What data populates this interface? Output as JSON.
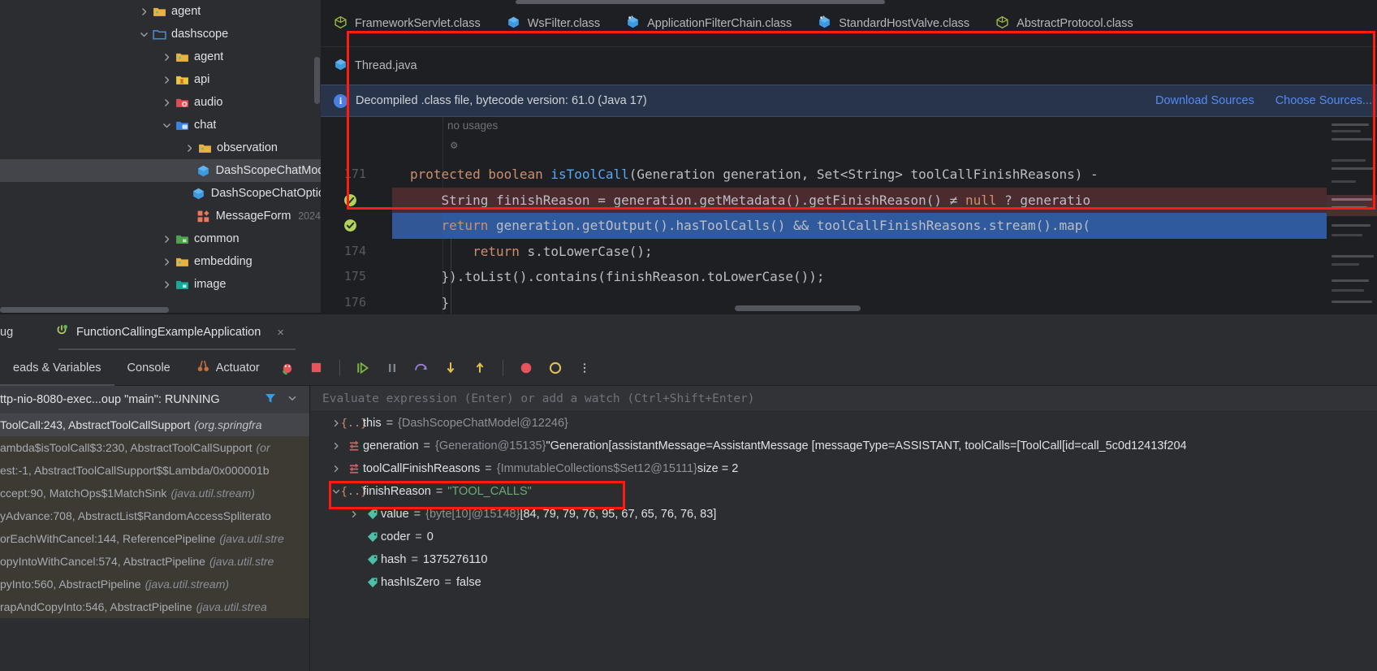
{
  "project_tree": {
    "items": [
      {
        "label": "agent",
        "indent": 1,
        "chevron": "right",
        "icon": "folder-yellow",
        "selected": false
      },
      {
        "label": "dashscope",
        "indent": 1,
        "chevron": "down",
        "icon": "folder-outline-blue",
        "selected": false
      },
      {
        "label": "agent",
        "indent": 2,
        "chevron": "right",
        "icon": "folder-yellow",
        "selected": false
      },
      {
        "label": "api",
        "indent": 2,
        "chevron": "right",
        "icon": "folder-api",
        "selected": false
      },
      {
        "label": "audio",
        "indent": 2,
        "chevron": "right",
        "icon": "folder-audio",
        "selected": false
      },
      {
        "label": "chat",
        "indent": 2,
        "chevron": "down",
        "icon": "folder-chat",
        "selected": false
      },
      {
        "label": "observation",
        "indent": 3,
        "chevron": "right",
        "icon": "folder-yellow",
        "selected": false
      },
      {
        "label": "DashScopeChatModel",
        "indent": 4,
        "chevron": "none",
        "icon": "class-blue",
        "selected": true
      },
      {
        "label": "DashScopeChatOptions",
        "indent": 4,
        "chevron": "none",
        "icon": "class-blue",
        "selected": false
      },
      {
        "label": "MessageFormat",
        "indent": 4,
        "chevron": "none",
        "icon": "enum-red",
        "selected": false,
        "date": "2024"
      },
      {
        "label": "common",
        "indent": 2,
        "chevron": "right",
        "icon": "folder-green",
        "selected": false
      },
      {
        "label": "embedding",
        "indent": 2,
        "chevron": "right",
        "icon": "folder-yellow",
        "selected": false
      },
      {
        "label": "image",
        "indent": 2,
        "chevron": "right",
        "icon": "folder-teal",
        "selected": false
      }
    ]
  },
  "editor": {
    "tabs_row1": [
      {
        "label": "FrameworkServlet.class",
        "icon": "class-green",
        "active": false
      },
      {
        "label": "WsFilter.class",
        "icon": "class-blue",
        "active": false
      },
      {
        "label": "ApplicationFilterChain.class",
        "icon": "class-blue-dot",
        "active": false
      },
      {
        "label": "StandardHostValve.class",
        "icon": "class-blue-dot",
        "active": false
      },
      {
        "label": "AbstractProtocol.class",
        "icon": "class-green",
        "active": false
      }
    ],
    "tabs_row2": [
      {
        "label": "Thread.java",
        "icon": "class-blue",
        "active": true
      }
    ],
    "banner": {
      "message": "Decompiled .class file, bytecode version: 61.0 (Java 17)",
      "link_download": "Download Sources",
      "link_choose": "Choose Sources..."
    },
    "hint_no_usages": "no usages",
    "lines": [
      {
        "num": "171",
        "gutter": "none",
        "highlight": "none",
        "tokens": [
          {
            "t": "protected ",
            "c": "kw"
          },
          {
            "t": "boolean ",
            "c": "kw"
          },
          {
            "t": "isToolCall",
            "c": "fnname"
          },
          {
            "t": "(Generation generation, Set<String> toolCallFinishReasons) -",
            "c": "plain"
          }
        ]
      },
      {
        "num": "",
        "gutter": "check",
        "highlight": "red",
        "tokens": [
          {
            "t": "    String finishReason = generation.getMetadata().getFinishReason() ",
            "c": "plain"
          },
          {
            "t": "≠ ",
            "c": "plain"
          },
          {
            "t": "null ",
            "c": "kw"
          },
          {
            "t": "? generatio",
            "c": "plain"
          }
        ]
      },
      {
        "num": "",
        "gutter": "check",
        "highlight": "blue",
        "tokens": [
          {
            "t": "    ",
            "c": "plain"
          },
          {
            "t": "return ",
            "c": "kw"
          },
          {
            "t": "generation.getOutput().hasToolCalls() && toolCallFinishReasons.stream().map(",
            "c": "plain"
          }
        ]
      },
      {
        "num": "174",
        "gutter": "none",
        "highlight": "none",
        "tokens": [
          {
            "t": "        ",
            "c": "plain"
          },
          {
            "t": "return ",
            "c": "kw"
          },
          {
            "t": "s.toLowerCase();",
            "c": "plain"
          }
        ]
      },
      {
        "num": "175",
        "gutter": "none",
        "highlight": "none",
        "tokens": [
          {
            "t": "    }).toList().contains(finishReason.toLowerCase());",
            "c": "plain"
          }
        ]
      },
      {
        "num": "176",
        "gutter": "none",
        "highlight": "none",
        "tokens": [
          {
            "t": "    }",
            "c": "plain"
          }
        ]
      }
    ]
  },
  "debug": {
    "panel_label": "ug",
    "run_config": "FunctionCallingExampleApplication",
    "close_label": "×",
    "tabs": [
      {
        "label": "eads & Variables",
        "icon": "none",
        "active": true
      },
      {
        "label": "Console",
        "icon": "none",
        "active": false
      },
      {
        "label": "Actuator",
        "icon": "actuator-icon",
        "active": false
      }
    ],
    "toolbar_icons": [
      "bug-icon",
      "stop-icon",
      "resume-icon",
      "pause-icon",
      "step-over-icon",
      "step-into-icon",
      "step-out-icon",
      "mute-breakpoints-icon",
      "settings-circle-icon",
      "more-options-icon"
    ],
    "thread_selector": "ttp-nio-8080-exec...oup \"main\": RUNNING",
    "frames": [
      {
        "text": "ToolCall:243, AbstractToolCallSupport ",
        "pkg": "(org.springfra",
        "selected": true,
        "lib": false
      },
      {
        "text": "ambda$isToolCall$3:230, AbstractToolCallSupport ",
        "pkg": "(or",
        "selected": false,
        "lib": true
      },
      {
        "text": "est:-1, AbstractToolCallSupport$$Lambda/0x000001b",
        "pkg": "",
        "selected": false,
        "lib": true
      },
      {
        "text": "ccept:90, MatchOps$1MatchSink ",
        "pkg": "(java.util.stream)",
        "selected": false,
        "lib": true
      },
      {
        "text": "yAdvance:708, AbstractList$RandomAccessSpliterato",
        "pkg": "",
        "selected": false,
        "lib": true
      },
      {
        "text": "orEachWithCancel:144, ReferencePipeline ",
        "pkg": "(java.util.stre",
        "selected": false,
        "lib": true
      },
      {
        "text": "opyIntoWithCancel:574, AbstractPipeline ",
        "pkg": "(java.util.stre",
        "selected": false,
        "lib": true
      },
      {
        "text": "pyInto:560, AbstractPipeline ",
        "pkg": "(java.util.stream)",
        "selected": false,
        "lib": true
      },
      {
        "text": "rapAndCopyInto:546, AbstractPipeline ",
        "pkg": "(java.util.strea",
        "selected": false,
        "lib": true
      }
    ],
    "evaluate_placeholder": "Evaluate expression (Enter) or add a watch (Ctrl+Shift+Enter)",
    "variables": [
      {
        "indent": 0,
        "chevron": "right",
        "icon": "object-icon",
        "name": "this",
        "ref": "{DashScopeChatModel@12246}",
        "value": "",
        "value_kind": "none"
      },
      {
        "indent": 0,
        "chevron": "right",
        "icon": "collection-icon",
        "name": "generation",
        "ref": "{Generation@15135}",
        "value": "\"Generation[assistantMessage=AssistantMessage [messageType=ASSISTANT, toolCalls=[ToolCall[id=call_5c0d12413f204",
        "value_kind": "string-plain"
      },
      {
        "indent": 0,
        "chevron": "right",
        "icon": "collection-icon",
        "name": "toolCallFinishReasons",
        "ref": "{ImmutableCollections$Set12@15111}",
        "value": "size = 2",
        "value_kind": "plain"
      },
      {
        "indent": 0,
        "chevron": "down",
        "icon": "object-icon",
        "name": "finishReason",
        "ref": "",
        "value": "\"TOOL_CALLS\"",
        "value_kind": "string"
      },
      {
        "indent": 1,
        "chevron": "right",
        "icon": "field-icon",
        "name": "value",
        "ref": "{byte[10]@15148}",
        "value": "[84, 79, 79, 76, 95, 67, 65, 76, 76, 83]",
        "value_kind": "plain"
      },
      {
        "indent": 1,
        "chevron": "none",
        "icon": "field-icon",
        "name": "coder",
        "ref": "",
        "value": "0",
        "value_kind": "plain"
      },
      {
        "indent": 1,
        "chevron": "none",
        "icon": "field-icon",
        "name": "hash",
        "ref": "",
        "value": "1375276110",
        "value_kind": "plain"
      },
      {
        "indent": 1,
        "chevron": "none",
        "icon": "field-icon",
        "name": "hashIsZero",
        "ref": "",
        "value": "false",
        "value_kind": "plain"
      }
    ]
  },
  "annotations": {
    "code_highlight_color": "#ff1a12",
    "var_highlight_color": "#ff1a12"
  }
}
